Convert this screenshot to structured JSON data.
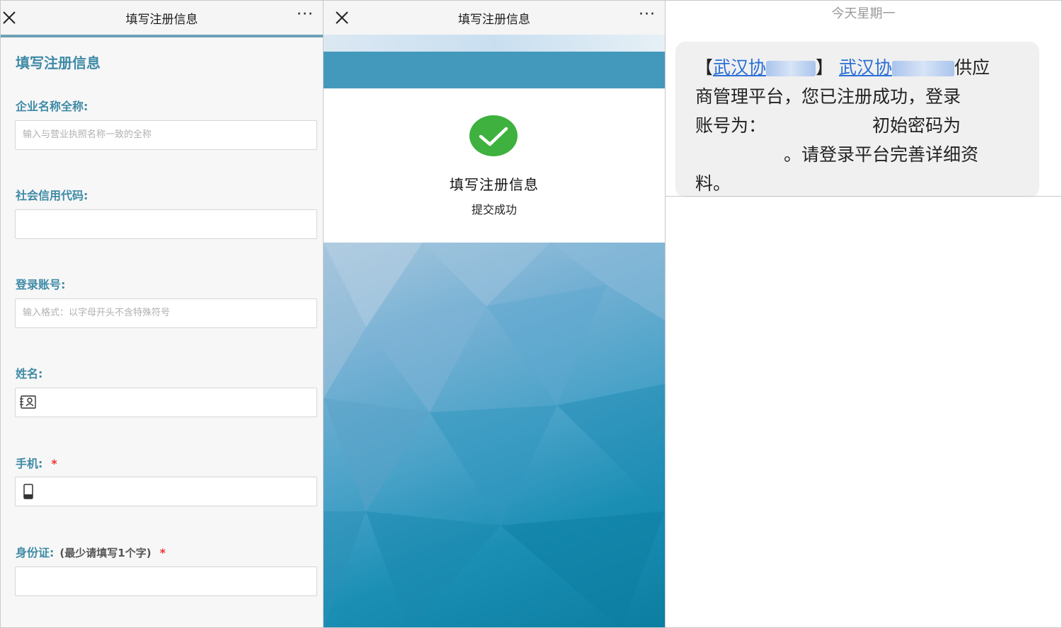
{
  "panel1": {
    "title": "填写注册信息",
    "more": "···",
    "form_title": "填写注册信息",
    "fields": [
      {
        "label": "企业名称全称:",
        "placeholder": "输入与营业执照名称一致的全称",
        "required": ""
      },
      {
        "label": "社会信用代码:",
        "placeholder": "",
        "required": ""
      },
      {
        "label": "登录账号:",
        "placeholder": "输入格式：以字母开头不含特殊符号",
        "required": ""
      },
      {
        "label": "姓名:",
        "placeholder": "",
        "required": ""
      },
      {
        "label": "手机:",
        "placeholder": "",
        "required": "*"
      },
      {
        "label": "身份证:",
        "hint": "(最少请填写1个字)",
        "placeholder": "",
        "required": "*"
      }
    ]
  },
  "panel2": {
    "title": "填写注册信息",
    "more": "···",
    "success_title": "填写注册信息",
    "success_sub": "提交成功",
    "accent": "#4399bb",
    "check_color": "#3eb13e"
  },
  "panel3": {
    "date": "今天星期一",
    "sms": {
      "bracket_open": "【",
      "hospital_prefix": "武汉协",
      "bracket_close": "】",
      "link2_prefix": "武汉协",
      "line1_tail": "供应",
      "line2": "商管理平台，您已注册成功，登录",
      "line3_a": "账号为：",
      "line3_b": "初始密码为",
      "line4": "。请登录平台完善详细资",
      "line5": "料。"
    }
  }
}
